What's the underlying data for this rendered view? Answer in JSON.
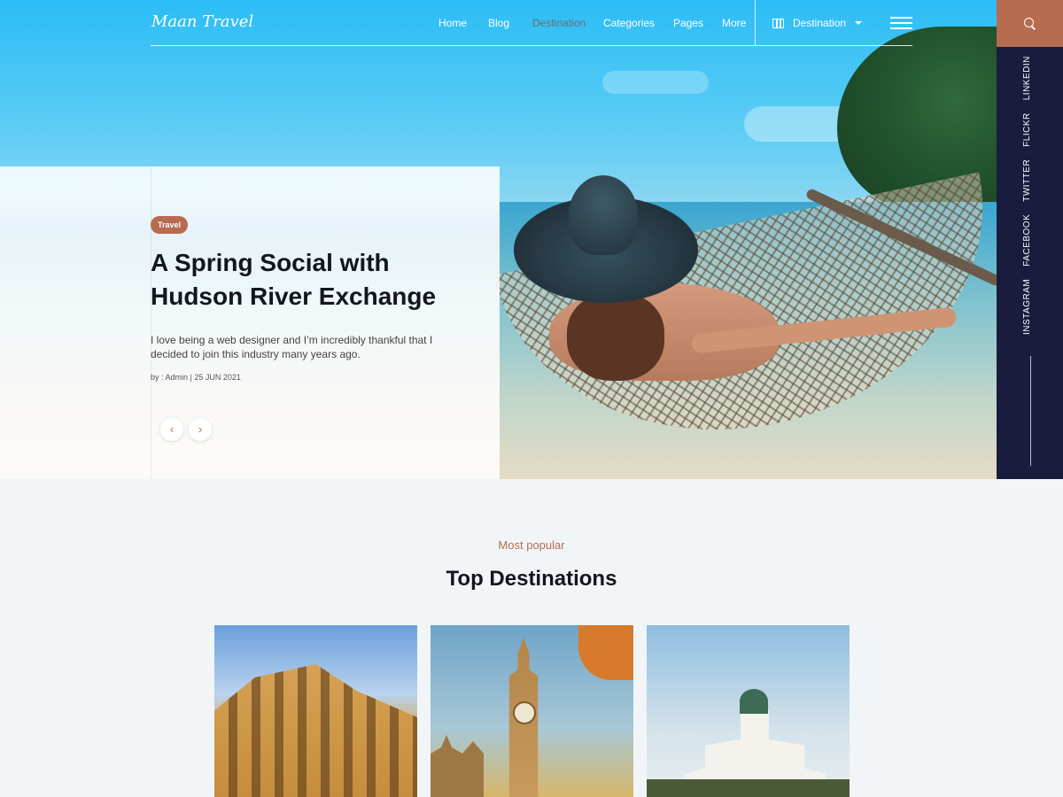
{
  "brand": {
    "logo": "Maan Travel"
  },
  "nav": {
    "items": [
      "Home",
      "Blog",
      "Destination",
      "Categories",
      "Pages",
      "More"
    ],
    "active": "Destination",
    "destination_select": "Destination"
  },
  "hero": {
    "badge": "Travel",
    "title": "A Spring Social with Hudson River Exchange",
    "text": "I love being a web designer and I’m incredibly thankful that I decided to join this industry many years ago.",
    "meta": "by : Admin | 25 JUN 2021",
    "prev_glyph": "‹",
    "next_glyph": "›"
  },
  "social": [
    "INSTAGRAM",
    "FACEBOOK",
    "TWITTER",
    "FLICKR",
    "LINKEDIN"
  ],
  "destinations": {
    "subtitle": "Most popular",
    "title": "Top Destinations"
  },
  "colors": {
    "accent": "#b76b4f",
    "sidebar": "#1a1c3d",
    "sky": "#2bbdf5"
  }
}
